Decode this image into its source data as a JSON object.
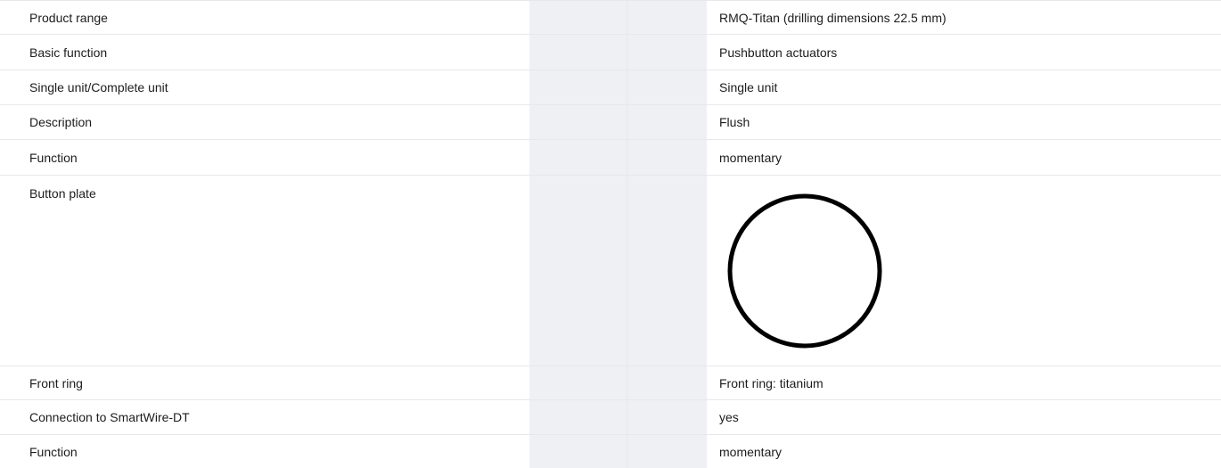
{
  "rows": [
    {
      "label": "Product range",
      "value": "RMQ-Titan (drilling dimensions 22.5 mm)"
    },
    {
      "label": "Basic function",
      "value": "Pushbutton actuators"
    },
    {
      "label": "Single unit/Complete unit",
      "value": "Single unit"
    },
    {
      "label": "Description",
      "value": "Flush"
    },
    {
      "label": "Function",
      "value": "momentary"
    },
    {
      "label": "Button plate",
      "value_image": "blank-circle-icon"
    },
    {
      "label": "Front ring",
      "value": "Front ring: titanium"
    },
    {
      "label": "Connection to SmartWire-DT",
      "value": "yes"
    },
    {
      "label": "Function",
      "value": "momentary"
    }
  ]
}
